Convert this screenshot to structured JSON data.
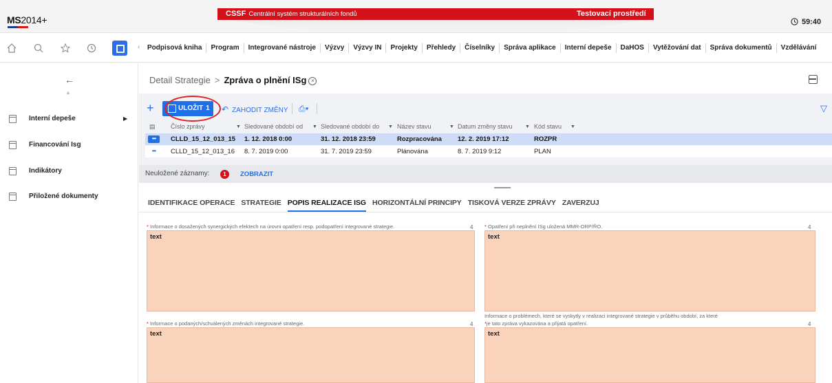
{
  "header": {
    "logo_bold": "MS",
    "logo_rest": "2014+",
    "env_system_code": "CSSF",
    "env_system_name": "Centrální systém strukturálních fondů",
    "env_label": "Testovací prostředí",
    "timer": "59:40"
  },
  "toolbar": {
    "icons": [
      "home-icon",
      "search-icon",
      "star-icon",
      "history-icon",
      "window-icon"
    ],
    "menu": [
      "Podpisová kniha",
      "Program",
      "Integrované nástroje",
      "Výzvy",
      "Výzvy IN",
      "Projekty",
      "Přehledy",
      "Číselníky",
      "Správa aplikace",
      "Interní depeše",
      "DaHOS",
      "Vytěžování dat",
      "Správa dokumentů",
      "Vzdělávání"
    ]
  },
  "sidebar": {
    "items": [
      {
        "label": "Interní depeše",
        "has_submenu": true
      },
      {
        "label": "Financování Isg",
        "has_submenu": false
      },
      {
        "label": "Indikátory",
        "has_submenu": false
      },
      {
        "label": "Přiložené dokumenty",
        "has_submenu": false
      }
    ]
  },
  "breadcrumb": {
    "parent": "Detail Strategie",
    "current": "Zpráva o plnění ISg"
  },
  "grid": {
    "save_label": "ULOŽIT",
    "save_count": "1",
    "discard_label": "ZAHODIT ZMĚNY",
    "columns": [
      "Číslo zprávy",
      "Sledované období od",
      "Sledované období do",
      "Název stavu",
      "Datum změny stavu",
      "Kód stavu"
    ],
    "rows": [
      {
        "selected": true,
        "cells": [
          "CLLD_15_12_013_15",
          "1. 12. 2018 0:00",
          "31. 12. 2018 23:59",
          "Rozpracována",
          "12. 2. 2019 17:12",
          "ROZPR"
        ]
      },
      {
        "selected": false,
        "cells": [
          "CLLD_15_12_013_16",
          "8. 7. 2019 0:00",
          "31. 7. 2019 23:59",
          "Plánována",
          "8. 7. 2019 9:12",
          "PLAN"
        ]
      }
    ],
    "unsaved_label": "Neuložené záznamy:",
    "unsaved_count": "1",
    "show_label": "ZOBRAZIT"
  },
  "tabs": [
    {
      "label": "IDENTIFIKACE OPERACE",
      "active": false
    },
    {
      "label": "STRATEGIE",
      "active": false
    },
    {
      "label": "POPIS REALIZACE ISG",
      "active": true
    },
    {
      "label": "HORIZONTÁLNÍ PRINCIPY",
      "active": false
    },
    {
      "label": "TISKOVÁ VERZE ZPRÁVY",
      "active": false
    },
    {
      "label": "ZAVERZUJ",
      "active": false
    }
  ],
  "fields": [
    {
      "required": true,
      "label": "Informace o dosažených synergických efektech na úrovni opatření resp. podopatření integrované strategie.",
      "count": "4",
      "value": "text"
    },
    {
      "required": true,
      "label": "Opatření při neplnění ISg uložená MMR-ORP/ŘO.",
      "count": "4",
      "value": "text"
    },
    {
      "required": true,
      "label": "Informace o podaných/schválených změnách integrované strategie.",
      "count": "4",
      "value": "text"
    },
    {
      "required": true,
      "label_line1": "Informace o problémech, které se vyskytly v realizaci integrované strategie v průběhu období, za které",
      "label_line2": "je tato zpráva vykazována a přijatá opatření.",
      "count": "4",
      "value": "text"
    }
  ],
  "colors": {
    "accent": "#1f6fe6",
    "env_bar": "#d4111b",
    "selected_row": "#cfdcf7",
    "textarea_required": "#f9d3bb"
  }
}
